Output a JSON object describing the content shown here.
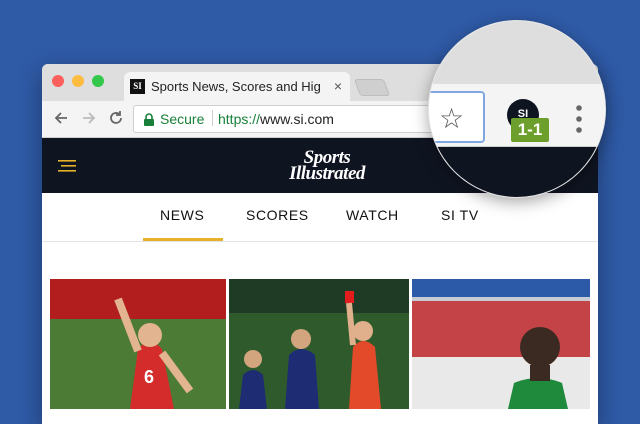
{
  "browser": {
    "tab_title": "Sports News, Scores and Highl",
    "tab_favicon": "SI",
    "tab_close": "×",
    "secure_label": "Secure",
    "url_scheme": "https://",
    "url_host": "www.si.com"
  },
  "site": {
    "logo_line1": "Sports",
    "logo_line2": "Illustrated",
    "nav": [
      "NEWS",
      "SCORES",
      "WATCH",
      "SI TV"
    ],
    "active_nav": "NEWS",
    "accent_color": "#e7b02b",
    "header_color": "#0f1421"
  },
  "extension": {
    "badge": "1-1",
    "badge_color": "#6c9f2b",
    "avatar_text": "SI",
    "bookmark_icon": "star-outline-icon",
    "menu_icon": "vertical-dots-icon"
  }
}
